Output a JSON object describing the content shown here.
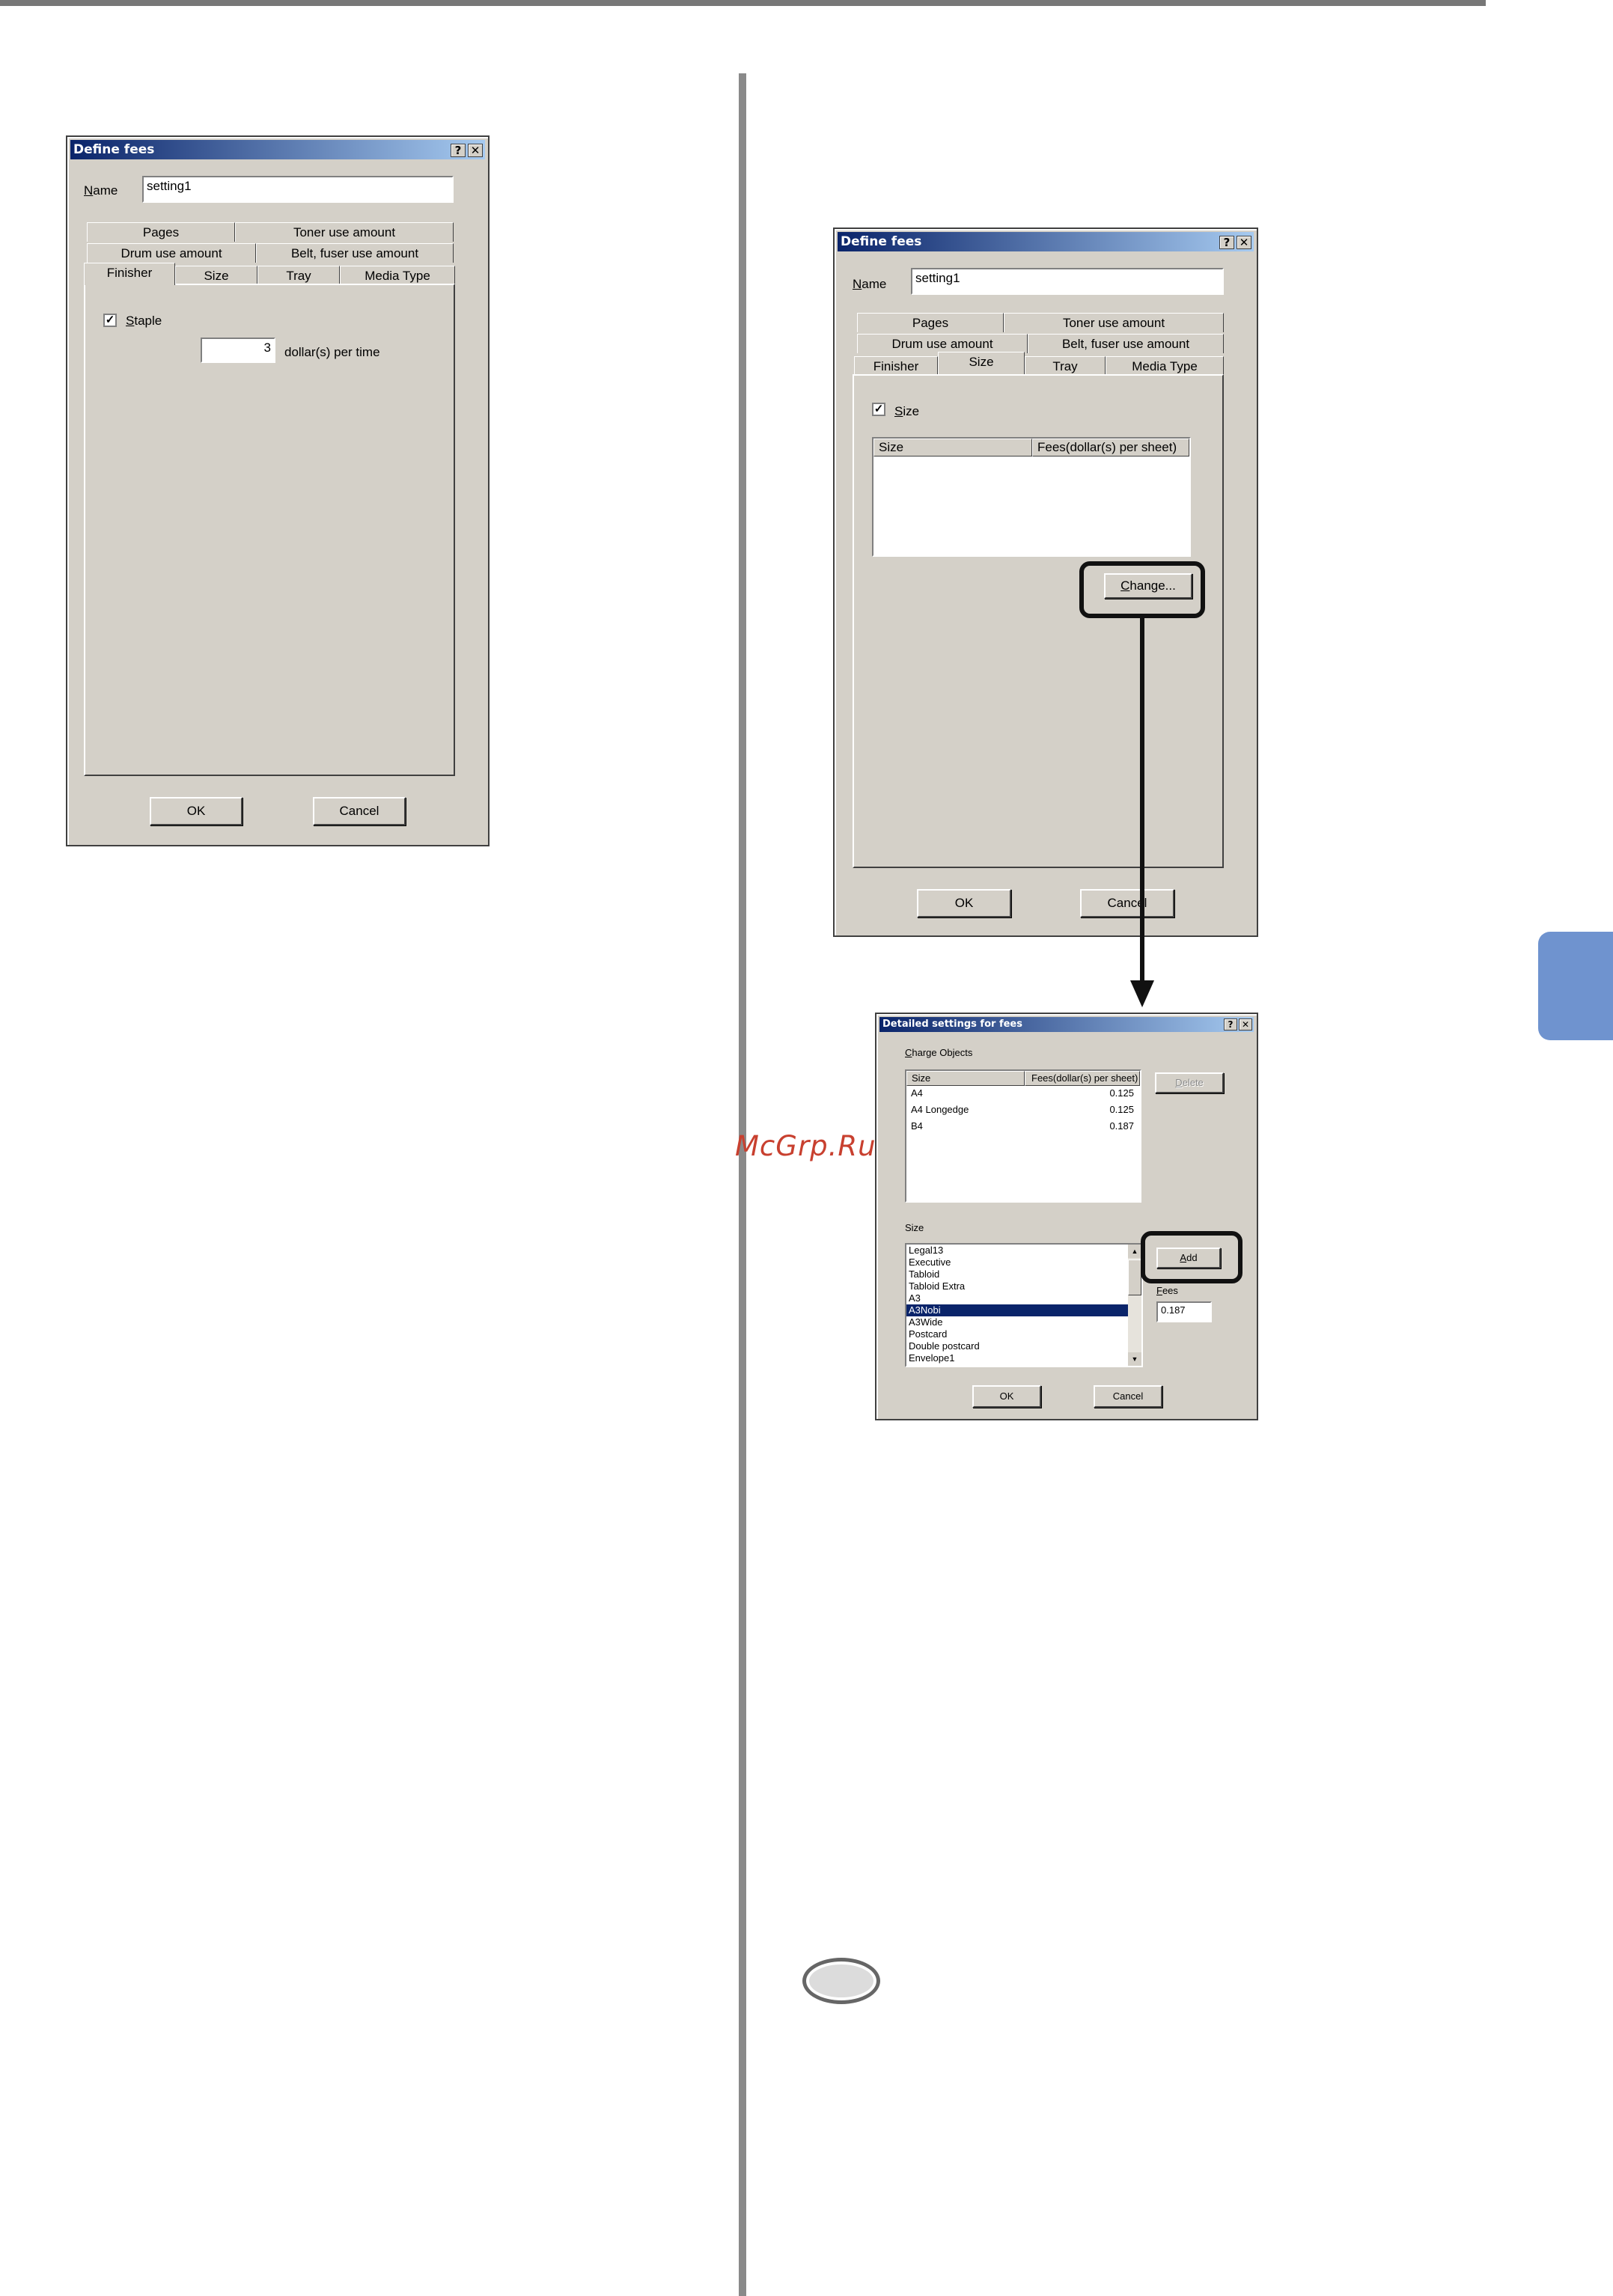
{
  "watermark": "McGrp.Ru",
  "dialog1": {
    "title": "Define fees",
    "help_btn": "?",
    "close_btn": "✕",
    "name_label": "Name",
    "name_value": "setting1",
    "tabs_row1": [
      "Pages",
      "Toner use amount"
    ],
    "tabs_row2": [
      "Drum use amount",
      "Belt, fuser use amount"
    ],
    "tabs_row3": [
      "Finisher",
      "Size",
      "Tray",
      "Media Type"
    ],
    "active_tab": "Finisher",
    "staple_label": "Staple",
    "staple_checked": true,
    "staple_value": "3",
    "staple_unit": "dollar(s) per time",
    "ok": "OK",
    "cancel": "Cancel"
  },
  "dialog2": {
    "title": "Define fees",
    "help_btn": "?",
    "close_btn": "✕",
    "name_label": "Name",
    "name_value": "setting1",
    "tabs_row1": [
      "Pages",
      "Toner use amount"
    ],
    "tabs_row2": [
      "Drum use amount",
      "Belt, fuser use amount"
    ],
    "tabs_row3": [
      "Finisher",
      "Size",
      "Tray",
      "Media Type"
    ],
    "active_tab": "Size",
    "size_label": "Size",
    "size_checked": true,
    "col_size": "Size",
    "col_fees": "Fees(dollar(s) per sheet)",
    "change_btn": "Change...",
    "ok": "OK",
    "cancel": "Cancel"
  },
  "dialog3": {
    "title": "Detailed settings for fees",
    "help_btn": "?",
    "close_btn": "✕",
    "charge_label": "Charge Objects",
    "col_size": "Size",
    "col_fees": "Fees(dollar(s) per sheet)",
    "rows": [
      {
        "size": "A4",
        "fee": "0.125"
      },
      {
        "size": "A4 Longedge",
        "fee": "0.125"
      },
      {
        "size": "B4",
        "fee": "0.187"
      }
    ],
    "delete_btn": "Delete",
    "size_label": "Size",
    "size_options": [
      "Legal13",
      "Executive",
      "Tabloid",
      "Tabloid Extra",
      "A3",
      "A3Nobi",
      "A3Wide",
      "Postcard",
      "Double postcard",
      "Envelope1"
    ],
    "selected_size": "A3Nobi",
    "add_btn": "Add",
    "fees_label": "Fees",
    "fees_value": "0.187",
    "ok": "OK",
    "cancel": "Cancel"
  }
}
